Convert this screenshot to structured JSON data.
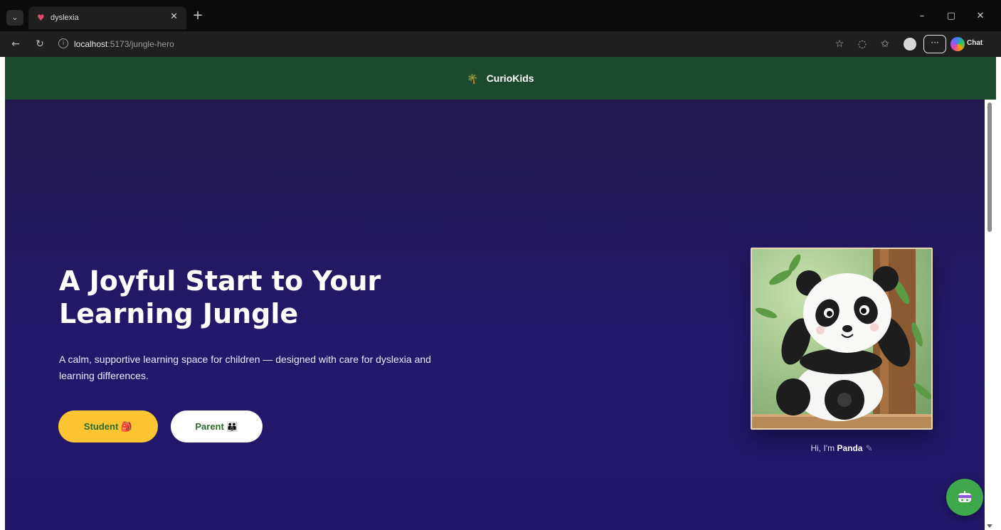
{
  "browser": {
    "tab_title": "dyslexia",
    "tab_close": "✕",
    "new_tab": "+",
    "url_host": "localhost",
    "url_path": ":5173/jungle-hero",
    "copilot_label": "Chat",
    "more_label": "···",
    "window_controls": {
      "minimize": "–",
      "maximize": "▢",
      "close": "✕"
    },
    "icons": [
      "tab-list-icon",
      "back-icon",
      "refresh-icon",
      "info-icon",
      "favorite-star-icon",
      "read-aloud-icon",
      "favorites-icon",
      "profile-icon",
      "more-icon",
      "copilot-icon"
    ]
  },
  "site": {
    "brand_icon": "🌴",
    "brand_name": "CurioKids",
    "header_color": "#1c4a2e"
  },
  "hero": {
    "title": "A Joyful Start to Your Learning Jungle",
    "subtitle": "A calm, supportive learning space for children — designed with care for dyslexia and learning differences.",
    "buttons": {
      "student": "Student 🎒",
      "parent": "Parent 👪"
    },
    "panda_caption_prefix": "Hi, I'm ",
    "panda_caption_name": "Panda",
    "panda_caption_suffix": "✎",
    "colors": {
      "background": "#23186a",
      "student_button": "#fac531",
      "parent_button": "#ffffff",
      "button_text": "#2a6a2f",
      "fab": "#3fa84c"
    }
  }
}
